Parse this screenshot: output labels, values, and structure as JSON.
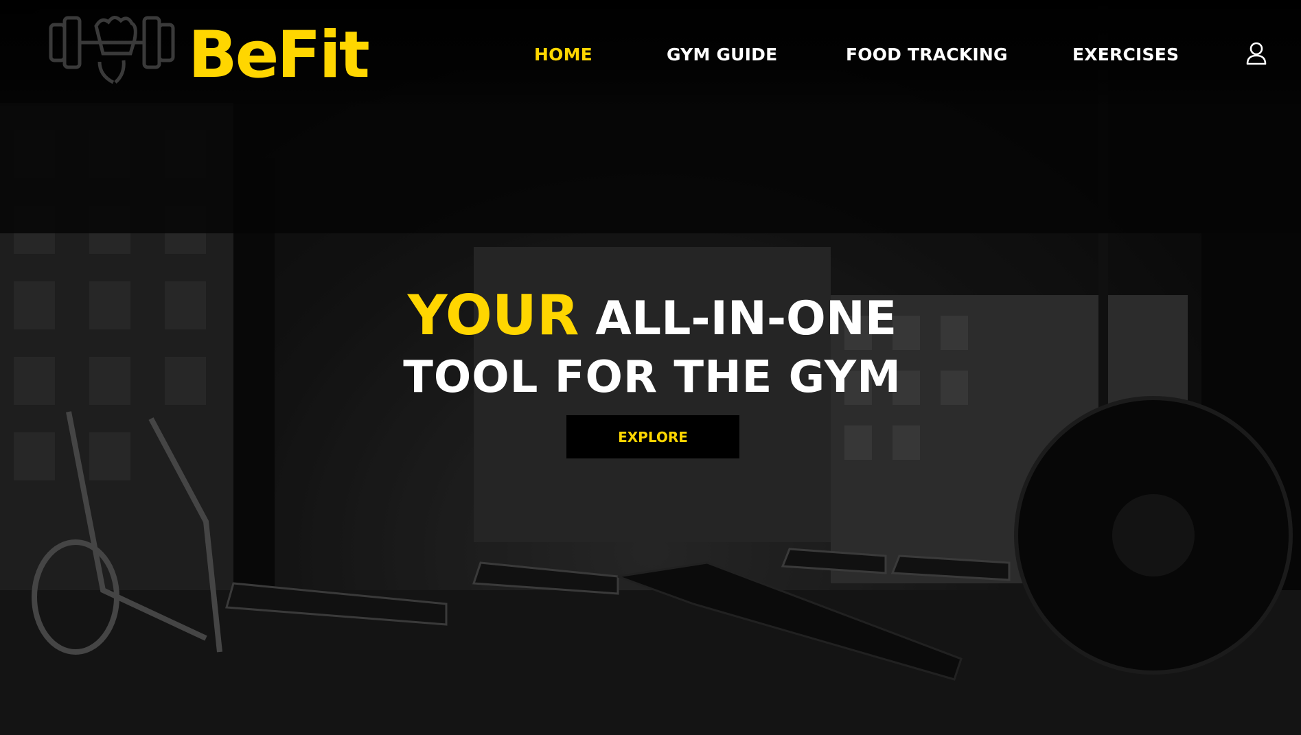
{
  "brand": {
    "name": "BeFit",
    "logo_icon": "dumbbell-fist-icon"
  },
  "nav": {
    "items": [
      {
        "label": "HOME",
        "active": true
      },
      {
        "label": "GYM GUIDE",
        "active": false
      },
      {
        "label": "FOOD TRACKING",
        "active": false
      },
      {
        "label": "EXERCISES",
        "active": false
      }
    ],
    "user_icon": "user-icon"
  },
  "hero": {
    "title_accent": "YOUR",
    "title_rest_line1": "ALL-IN-ONE",
    "title_line2": "TOOL FOR THE GYM",
    "cta_label": "EXPLORE"
  },
  "colors": {
    "accent": "#FFD600",
    "text": "#FFFFFF",
    "background": "#000000",
    "button_bg": "#000000"
  }
}
